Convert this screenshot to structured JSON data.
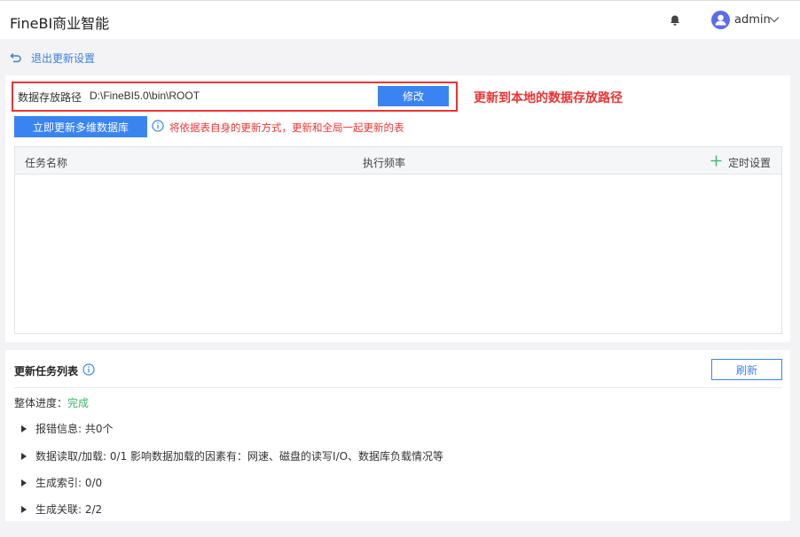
{
  "header": {
    "app_title": "FineBI商业智能",
    "user_name": "admin"
  },
  "nav": {
    "back_label": "退出更新设置"
  },
  "path_setting": {
    "label": "数据存放路径",
    "value": "D:\\FineBI5.0\\bin\\ROOT",
    "modify_label": "修改",
    "annotation": "更新到本地的数据存放路径"
  },
  "update": {
    "button_label": "立即更新多维数据库",
    "info_text": "将依据表自身的更新方式，更新和全局一起更新的表"
  },
  "schedule_table": {
    "columns": [
      "任务名称",
      "执行频率",
      "定时设置"
    ],
    "rows": []
  },
  "task_list": {
    "title": "更新任务列表",
    "refresh_label": "刷新",
    "progress_label": "整体进度：",
    "progress_status": "完成",
    "items": [
      "报错信息: 共0个",
      "数据读取/加载: 0/1 影响数据加载的因素有：网速、磁盘的读写I/O、数据库负载情况等",
      "生成索引: 0/0",
      "生成关联: 2/2"
    ]
  },
  "colors": {
    "accent": "#3a84f2",
    "alert": "#ee3333",
    "success": "#3fb56b"
  }
}
